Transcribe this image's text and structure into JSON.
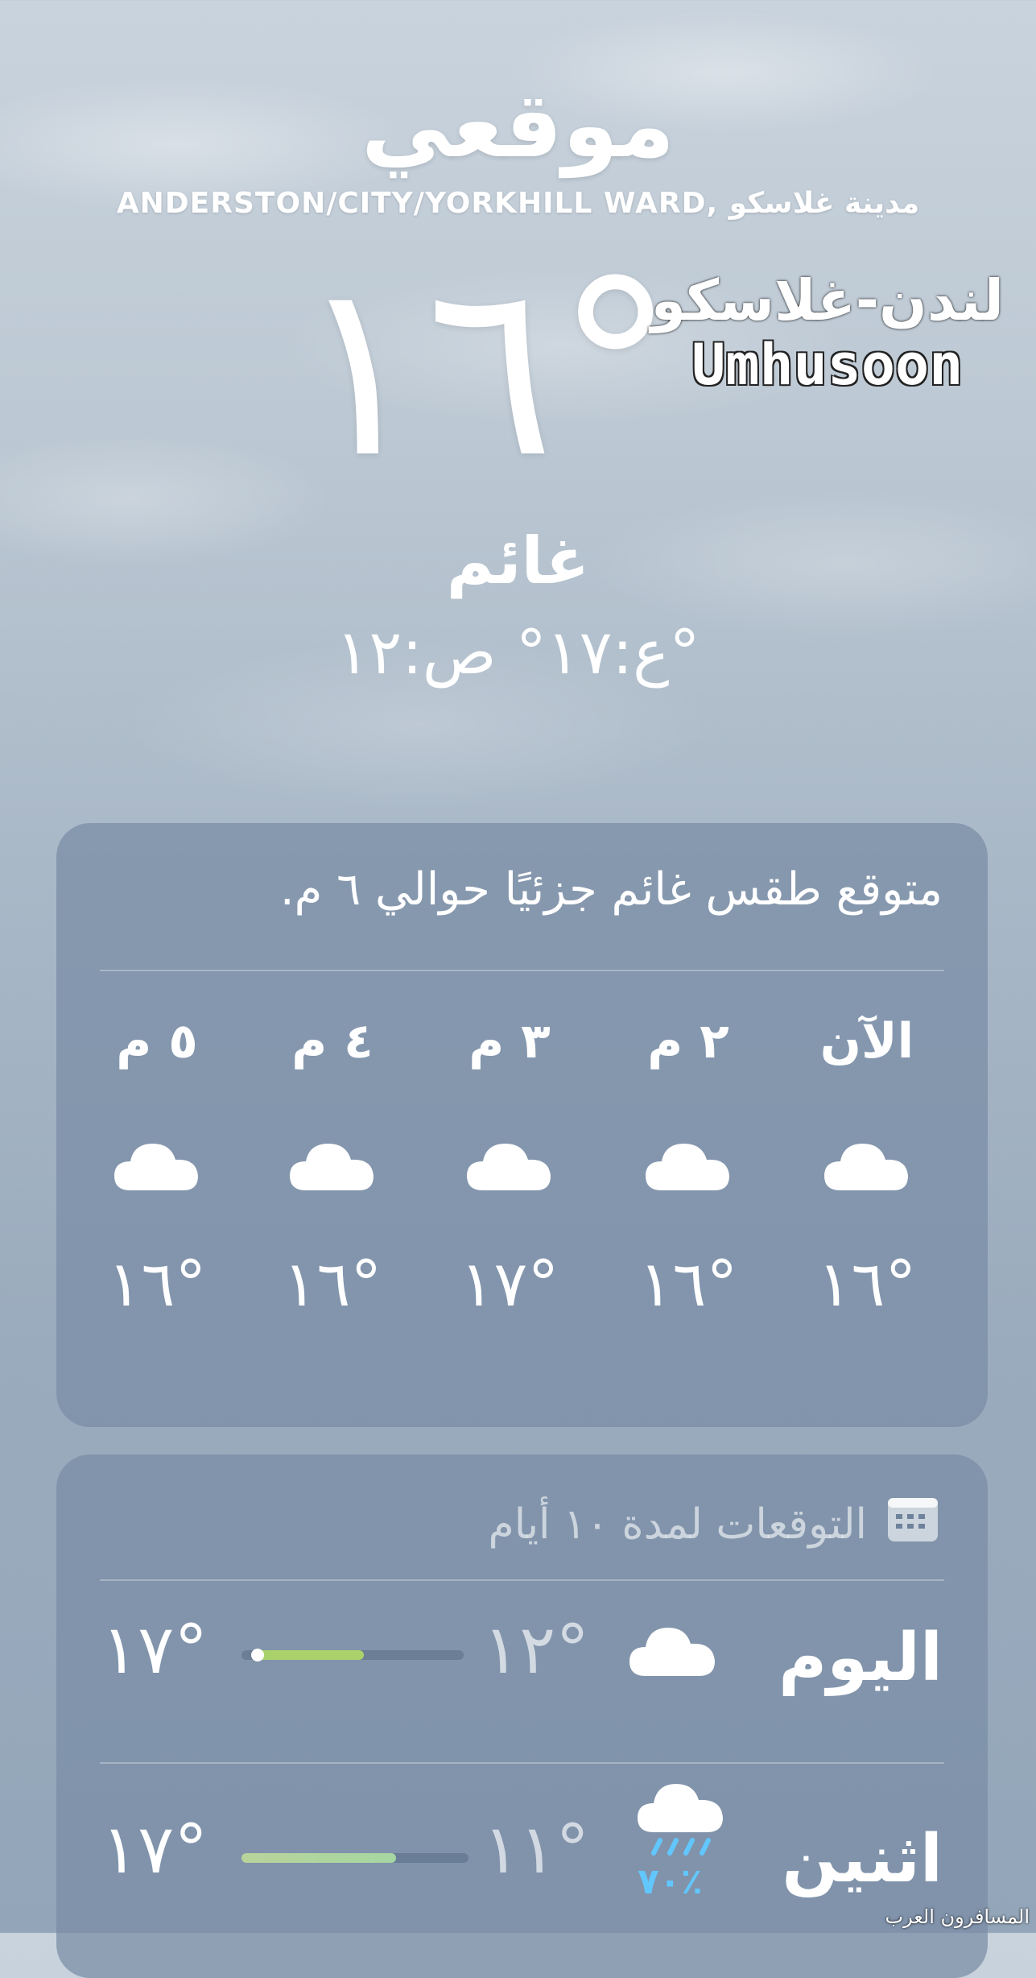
{
  "location": {
    "title": "موقعي",
    "subtitle": "ANDERSTON/CITY/YORKHILL WARD, مدينة غلاسكو",
    "temperature": "١٦°",
    "condition": "غائم",
    "hilo": "ع:١٧° ص:١٢°"
  },
  "watermark": {
    "line1": "لندن-غلاسكو",
    "line2": "Umhusoon"
  },
  "hourly": {
    "summary": "متوقع طقس غائم جزئيًا حوالي ٦ م.",
    "items": [
      {
        "label": "الآن",
        "icon": "cloud-icon",
        "temp": "١٦°"
      },
      {
        "label": "٢ م",
        "icon": "cloud-icon",
        "temp": "١٦°"
      },
      {
        "label": "٣ م",
        "icon": "cloud-icon",
        "temp": "١٧°"
      },
      {
        "label": "٤ م",
        "icon": "cloud-icon",
        "temp": "١٦°"
      },
      {
        "label": "٥ م",
        "icon": "cloud-icon",
        "temp": "١٦°"
      }
    ]
  },
  "daily": {
    "title": "التوقعات لمدة ١٠ أيام",
    "icon": "calendar-icon",
    "rows": [
      {
        "day": "اليوم",
        "icon": "cloud-icon",
        "low": "١٢°",
        "high": "١٧°",
        "range_start": 0.05,
        "range_end": 0.55,
        "current_marker": 0.08
      },
      {
        "day": "اثنين",
        "icon": "rain-cloud-icon",
        "precip": "٧٠٪",
        "low": "١١°",
        "high": "١٧°",
        "range_start": 0.0,
        "range_end": 0.68
      }
    ]
  },
  "colors": {
    "bar_fill_today": "#a9d36a",
    "bar_fill_next": "#b8d49a",
    "precip": "#62c7ff"
  },
  "footer_logo": "المسافرون العرب"
}
